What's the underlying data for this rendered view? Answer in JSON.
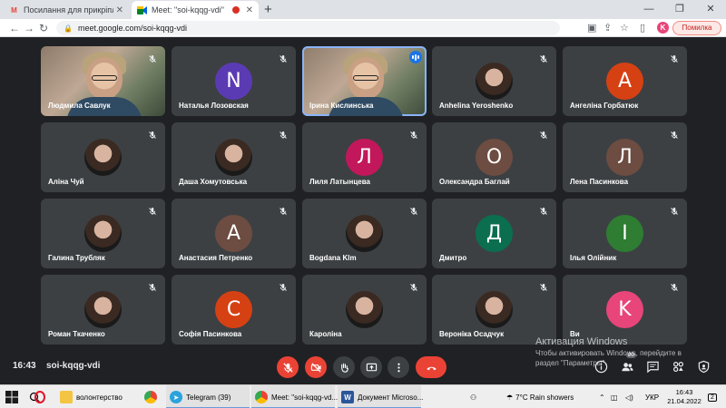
{
  "browser": {
    "tabs": [
      {
        "title": "Посилання для прикріплення до...",
        "icon": "gmail-icon",
        "active": false
      },
      {
        "title": "Meet: \"soi-kqqg-vdi\"",
        "icon": "meet-icon",
        "active": true,
        "recording": true
      }
    ],
    "url": "meet.google.com/soi-kqqg-vdi",
    "profile_initial": "K",
    "error_label": "Помилка"
  },
  "meet": {
    "participants": [
      {
        "name": "Людмила Савлук",
        "type": "video",
        "muted": true
      },
      {
        "name": "Наталья Лозовская",
        "type": "initial",
        "initial": "N",
        "color": "#5b3bb3",
        "muted": true
      },
      {
        "name": "Ірина Кислинська",
        "type": "video",
        "muted": false,
        "speaking": true
      },
      {
        "name": "Anhelina Yeroshenko",
        "type": "photo",
        "muted": true
      },
      {
        "name": "Ангеліна Горбатюк",
        "type": "initial",
        "initial": "A",
        "color": "#d64113",
        "muted": true
      },
      {
        "name": "Аліна Чуй",
        "type": "photo",
        "muted": true
      },
      {
        "name": "Даша Хомутовська",
        "type": "photo",
        "muted": true
      },
      {
        "name": "Лиля Латынцева",
        "type": "initial",
        "initial": "Л",
        "color": "#c2185b",
        "muted": true
      },
      {
        "name": "Олександра Баглай",
        "type": "initial",
        "initial": "O",
        "color": "#6d4c41",
        "muted": true
      },
      {
        "name": "Лена Пасинкова",
        "type": "initial",
        "initial": "Л",
        "color": "#6d4c41",
        "muted": true
      },
      {
        "name": "Галина Трубляк",
        "type": "photo",
        "muted": true
      },
      {
        "name": "Анастасия Петренко",
        "type": "initial",
        "initial": "А",
        "color": "#6d4c41",
        "muted": true
      },
      {
        "name": "Bogdana Klm",
        "type": "photo",
        "muted": true
      },
      {
        "name": "Дмитро",
        "type": "initial",
        "initial": "Д",
        "color": "#0b6e4f",
        "muted": true
      },
      {
        "name": "Ілья Олійник",
        "type": "initial",
        "initial": "І",
        "color": "#2e7d32",
        "muted": true
      },
      {
        "name": "Роман Ткаченко",
        "type": "photo",
        "muted": true
      },
      {
        "name": "Софія Пасинкова",
        "type": "initial",
        "initial": "С",
        "color": "#d64113",
        "muted": true
      },
      {
        "name": "Кароліна",
        "type": "photo",
        "muted": true
      },
      {
        "name": "Вероніка Осадчук",
        "type": "photo",
        "muted": true
      },
      {
        "name": "Ви",
        "type": "initial",
        "initial": "K",
        "color": "#e8457a",
        "muted": true
      }
    ],
    "time": "16:43",
    "meeting_code": "soi-kqqg-vdi",
    "participants_badge": "20"
  },
  "watermark": {
    "line1": "Активация Windows",
    "line2": "Чтобы активировать Windows, перейдите в",
    "line3": "раздел \"Параметры\"."
  },
  "taskbar": {
    "items": [
      {
        "label": "",
        "icon": "windows-start-icon"
      },
      {
        "label": "",
        "icon": "search-icon"
      },
      {
        "label": "",
        "icon": "opera-icon"
      },
      {
        "label": "волонтерство",
        "icon": "folder-icon"
      },
      {
        "label": "",
        "icon": "chrome-icon"
      },
      {
        "label": "Telegram (39)",
        "icon": "telegram-icon"
      },
      {
        "label": "Meet: \"soi-kqqg-vd...",
        "icon": "chrome-icon"
      },
      {
        "label": "Документ Microso...",
        "icon": "word-icon"
      }
    ],
    "weather": "7°C  Rain showers",
    "lang": "УКР",
    "time": "16:43",
    "date": "21.04.2022",
    "notifications": "2"
  },
  "colors": {
    "meet_bg": "#202124",
    "tile_bg": "#3c4043",
    "end_red": "#ea4335",
    "speak_blue": "#1a73e8"
  }
}
